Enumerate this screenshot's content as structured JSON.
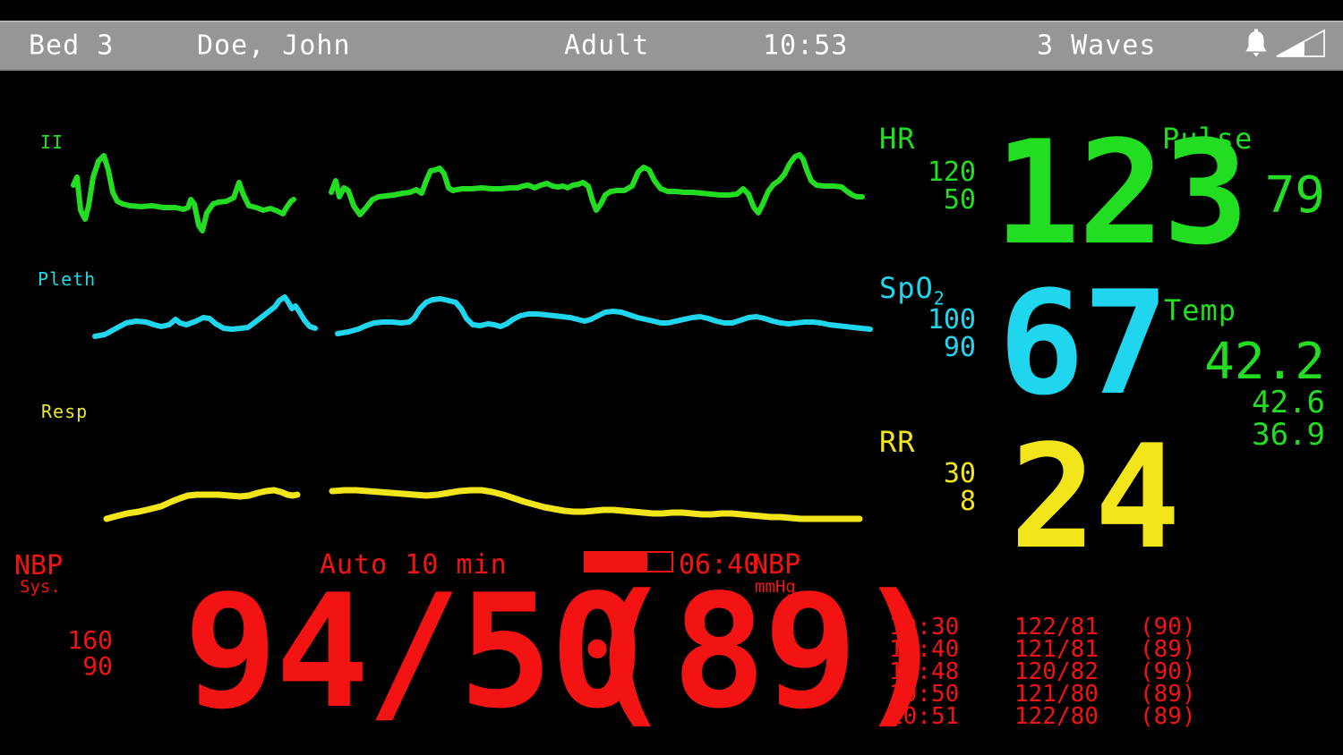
{
  "header": {
    "bed": "Bed 3",
    "patient_name": "Doe, John",
    "patient_type": "Adult",
    "time": "10:53",
    "waves": "3 Waves",
    "alarm_icon": "bell-icon",
    "volume_icon": "volume-signal-icon",
    "bg_color": "#969696",
    "text_color": "#ffffff"
  },
  "waveforms": [
    {
      "label": "II",
      "color": "#22dd22",
      "type": "ecg"
    },
    {
      "label": "Pleth",
      "color": "#1fd6ee",
      "type": "pleth"
    },
    {
      "label": "Resp",
      "color": "#f2e61a",
      "type": "resp"
    }
  ],
  "numerics": {
    "hr": {
      "label": "HR",
      "limit_high": "120",
      "limit_low": "50",
      "value": "123",
      "color": "#22dd22"
    },
    "pulse": {
      "label": "Pulse",
      "value": "79",
      "color": "#22dd22"
    },
    "spo2": {
      "label": "SpO",
      "label_sub": "2",
      "limit_high": "100",
      "limit_low": "90",
      "value": "67",
      "color": "#1fd6ee"
    },
    "temp": {
      "label": "Temp",
      "value": "42.2",
      "value2": "42.6",
      "value3": "36.9",
      "color": "#22dd22"
    },
    "rr": {
      "label": "RR",
      "limit_high": "30",
      "limit_low": "8",
      "value": "24",
      "color": "#f2e61a"
    }
  },
  "nbp": {
    "label": "NBP",
    "sublabel": "Sys.",
    "limit_high": "160",
    "limit_low": "90",
    "mode": "Auto 10 min",
    "value": "94/50",
    "map": "(89)",
    "unit_label": "NBP",
    "unit": "mmHg",
    "countdown": "06:40",
    "progress_percent": 72,
    "color": "#f31313",
    "history_rows": [
      {
        "time": "10:30",
        "bp": "122/81",
        "map": "(90)"
      },
      {
        "time": "10:40",
        "bp": "121/81",
        "map": "(89)"
      },
      {
        "time": "10:48",
        "bp": "120/82",
        "map": "(90)"
      },
      {
        "time": "10:50",
        "bp": "121/80",
        "map": "(89)"
      },
      {
        "time": "10:51",
        "bp": "122/80",
        "map": "(89)"
      }
    ]
  }
}
